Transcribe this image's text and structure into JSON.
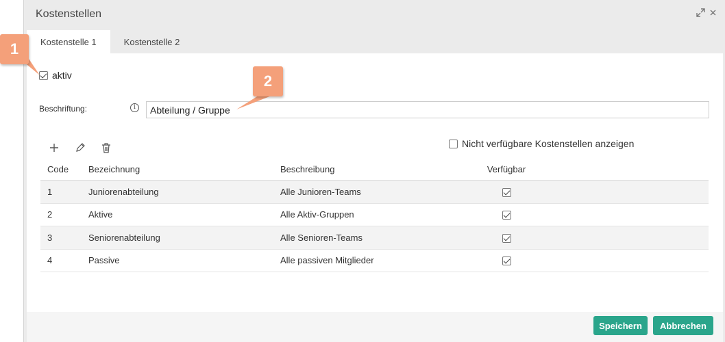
{
  "dialog": {
    "title": "Kostenstellen",
    "tabs": [
      {
        "label": "Kostenstelle 1",
        "active": true
      },
      {
        "label": "Kostenstelle 2",
        "active": false
      }
    ]
  },
  "form": {
    "aktiv_label": "aktiv",
    "aktiv_checked": true,
    "beschriftung_label": "Beschriftung:",
    "beschriftung_value": "Abteilung / Gruppe",
    "show_unavailable_label": "Nicht verfügbare Kostenstellen anzeigen",
    "show_unavailable_checked": false
  },
  "table": {
    "columns": [
      "Code",
      "Bezeichnung",
      "Beschreibung",
      "Verfügbar"
    ],
    "rows": [
      {
        "code": "1",
        "bezeichnung": "Juniorenabteilung",
        "beschreibung": "Alle Junioren-Teams",
        "verfuegbar": true
      },
      {
        "code": "2",
        "bezeichnung": "Aktive",
        "beschreibung": "Alle Aktiv-Gruppen",
        "verfuegbar": true
      },
      {
        "code": "3",
        "bezeichnung": "Seniorenabteilung",
        "beschreibung": "Alle Senioren-Teams",
        "verfuegbar": true
      },
      {
        "code": "4",
        "bezeichnung": "Passive",
        "beschreibung": "Alle passiven Mitglieder",
        "verfuegbar": true
      }
    ]
  },
  "buttons": {
    "save": "Speichern",
    "cancel": "Abbrechen"
  },
  "callouts": [
    "1",
    "2"
  ],
  "icons": {
    "add": "plus-icon",
    "edit": "pencil-icon",
    "delete": "trash-icon",
    "info": "info-icon",
    "maximize": "expand-icon",
    "close": "close-icon"
  },
  "colors": {
    "accent": "#2aa58b",
    "callout": "#f4a07a",
    "dialog_bg": "#ebebeb"
  }
}
